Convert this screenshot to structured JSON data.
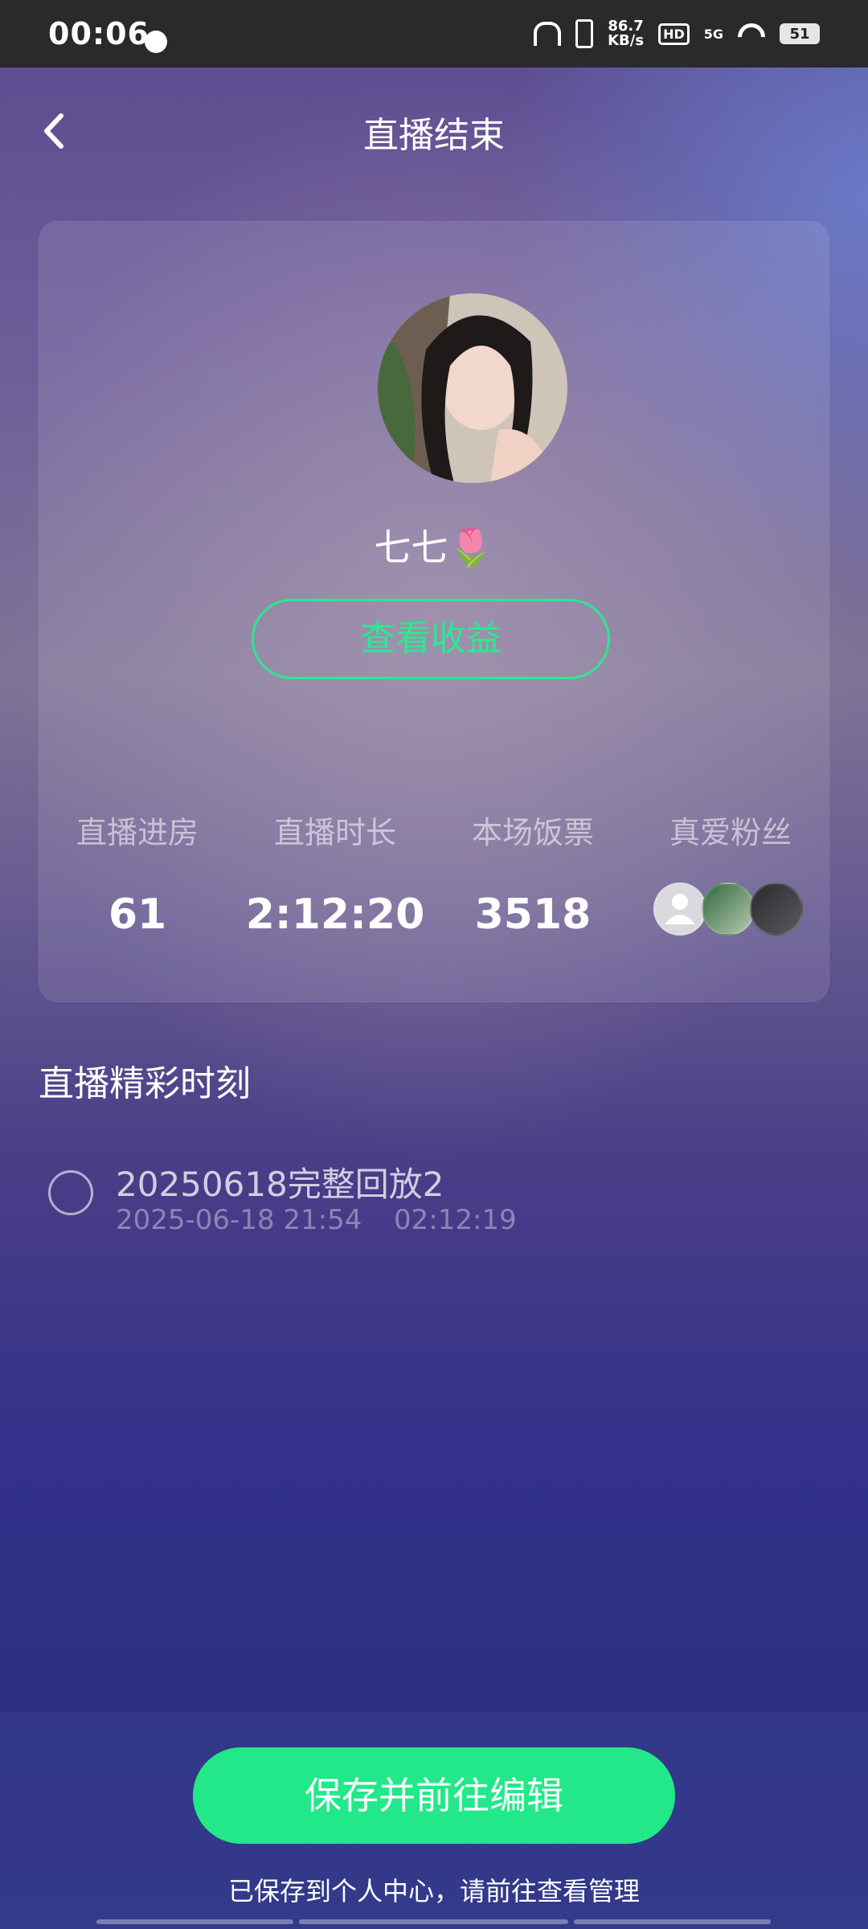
{
  "status_bar": {
    "time": "00:06",
    "net_speed_value": "86.7",
    "net_speed_unit": "KB/s",
    "hd_label": "HD",
    "signal_label": "5G",
    "battery": "51"
  },
  "header": {
    "title": "直播结束",
    "back_icon": "chevron-left-icon"
  },
  "profile": {
    "nickname": "七七🌷",
    "income_button": "查看收益"
  },
  "stats": [
    {
      "label": "直播进房",
      "value": "61"
    },
    {
      "label": "直播时长",
      "value": "2:12:20"
    },
    {
      "label": "本场饭票",
      "value": "3518"
    },
    {
      "label": "真爱粉丝"
    }
  ],
  "highlights": {
    "section_title": "直播精彩时刻",
    "clips": [
      {
        "name": "20250618完整回放2",
        "date": "2025-06-18 21:54",
        "duration": "02:12:19"
      }
    ]
  },
  "footer": {
    "save_button": "保存并前往编辑",
    "tip": "已保存到个人中心，请前往查看管理"
  },
  "colors": {
    "accent": "#22e88a",
    "accent_outline": "#2de88f"
  }
}
